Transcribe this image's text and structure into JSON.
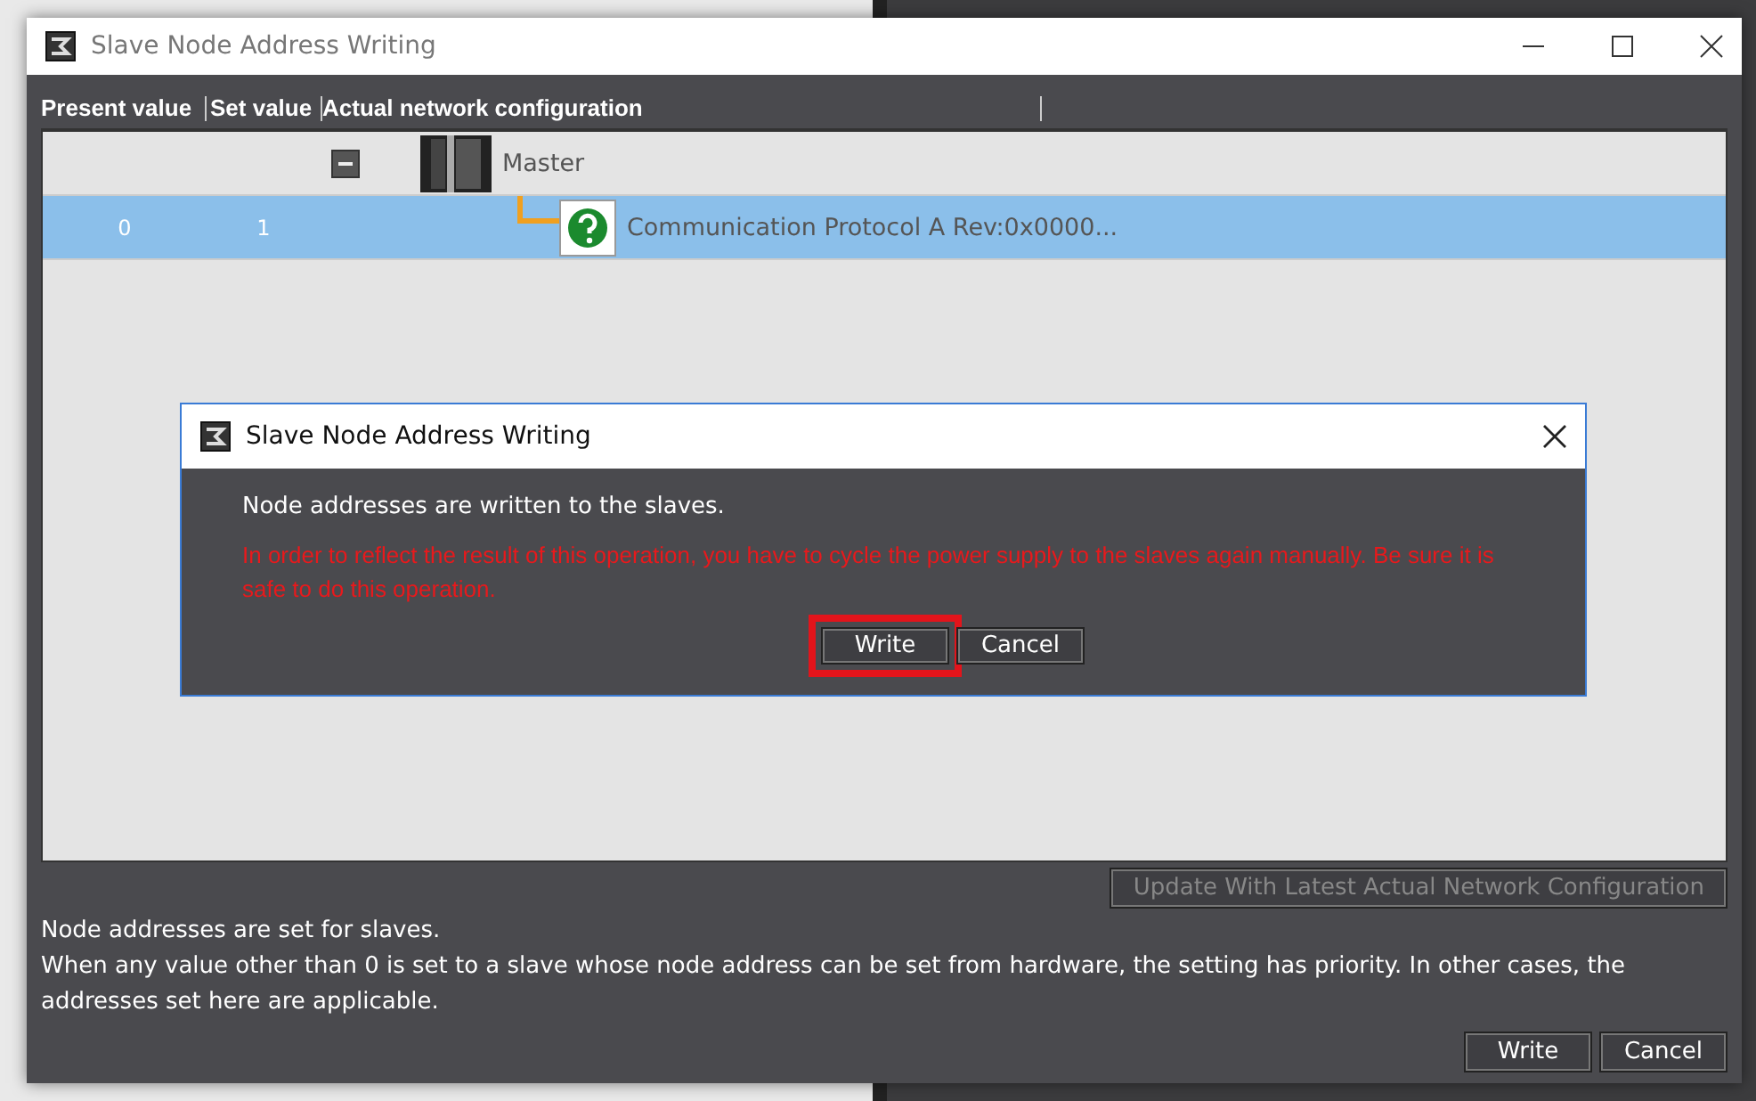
{
  "window": {
    "title": "Slave Node Address Writing"
  },
  "table": {
    "columns": [
      "Present value",
      "Set value",
      "Actual network configuration"
    ],
    "rows": [
      {
        "present": "",
        "set": "",
        "name": "Master",
        "kind": "master",
        "expanded": true,
        "selected": false,
        "children": [
          {
            "present": "0",
            "set": "1",
            "name": "Communication Protocol A Rev:0x0000...",
            "kind": "unknown",
            "selected": true
          }
        ]
      }
    ]
  },
  "update_button": {
    "label": "Update With Latest Actual Network Configuration",
    "disabled": true
  },
  "info": [
    "Node addresses are set for slaves.",
    "When any value other than 0 is set to a slave whose node address can be set from hardware, the setting has priority. In other cases, the addresses set here are applicable."
  ],
  "buttons": [
    {
      "label": "Write",
      "disabled": false
    },
    {
      "label": "Cancel",
      "disabled": false
    }
  ],
  "dialog": {
    "title": "Slave Node Address Writing",
    "message": "Node addresses are written to the slaves.",
    "warning": "In order to reflect the result of this operation, you have to cycle the power supply to the slaves again manually. Be sure it is safe to do this operation.",
    "buttons": [
      {
        "label": "Write",
        "highlighted": true
      },
      {
        "label": "Cancel",
        "highlighted": false
      }
    ]
  }
}
